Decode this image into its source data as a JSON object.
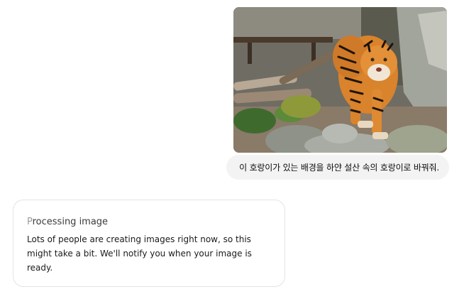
{
  "user_message": {
    "image_icon": "tiger-photo",
    "text": "이 호랑이가 있는 배경을 하얀 설산 속의 호랑이로 바꿔줘."
  },
  "assistant_message": {
    "status_title_first": "P",
    "status_title_rest": "rocessing image",
    "status_body": "Lots of people are creating images right now, so this might take a bit. We'll notify you when your image is ready."
  }
}
